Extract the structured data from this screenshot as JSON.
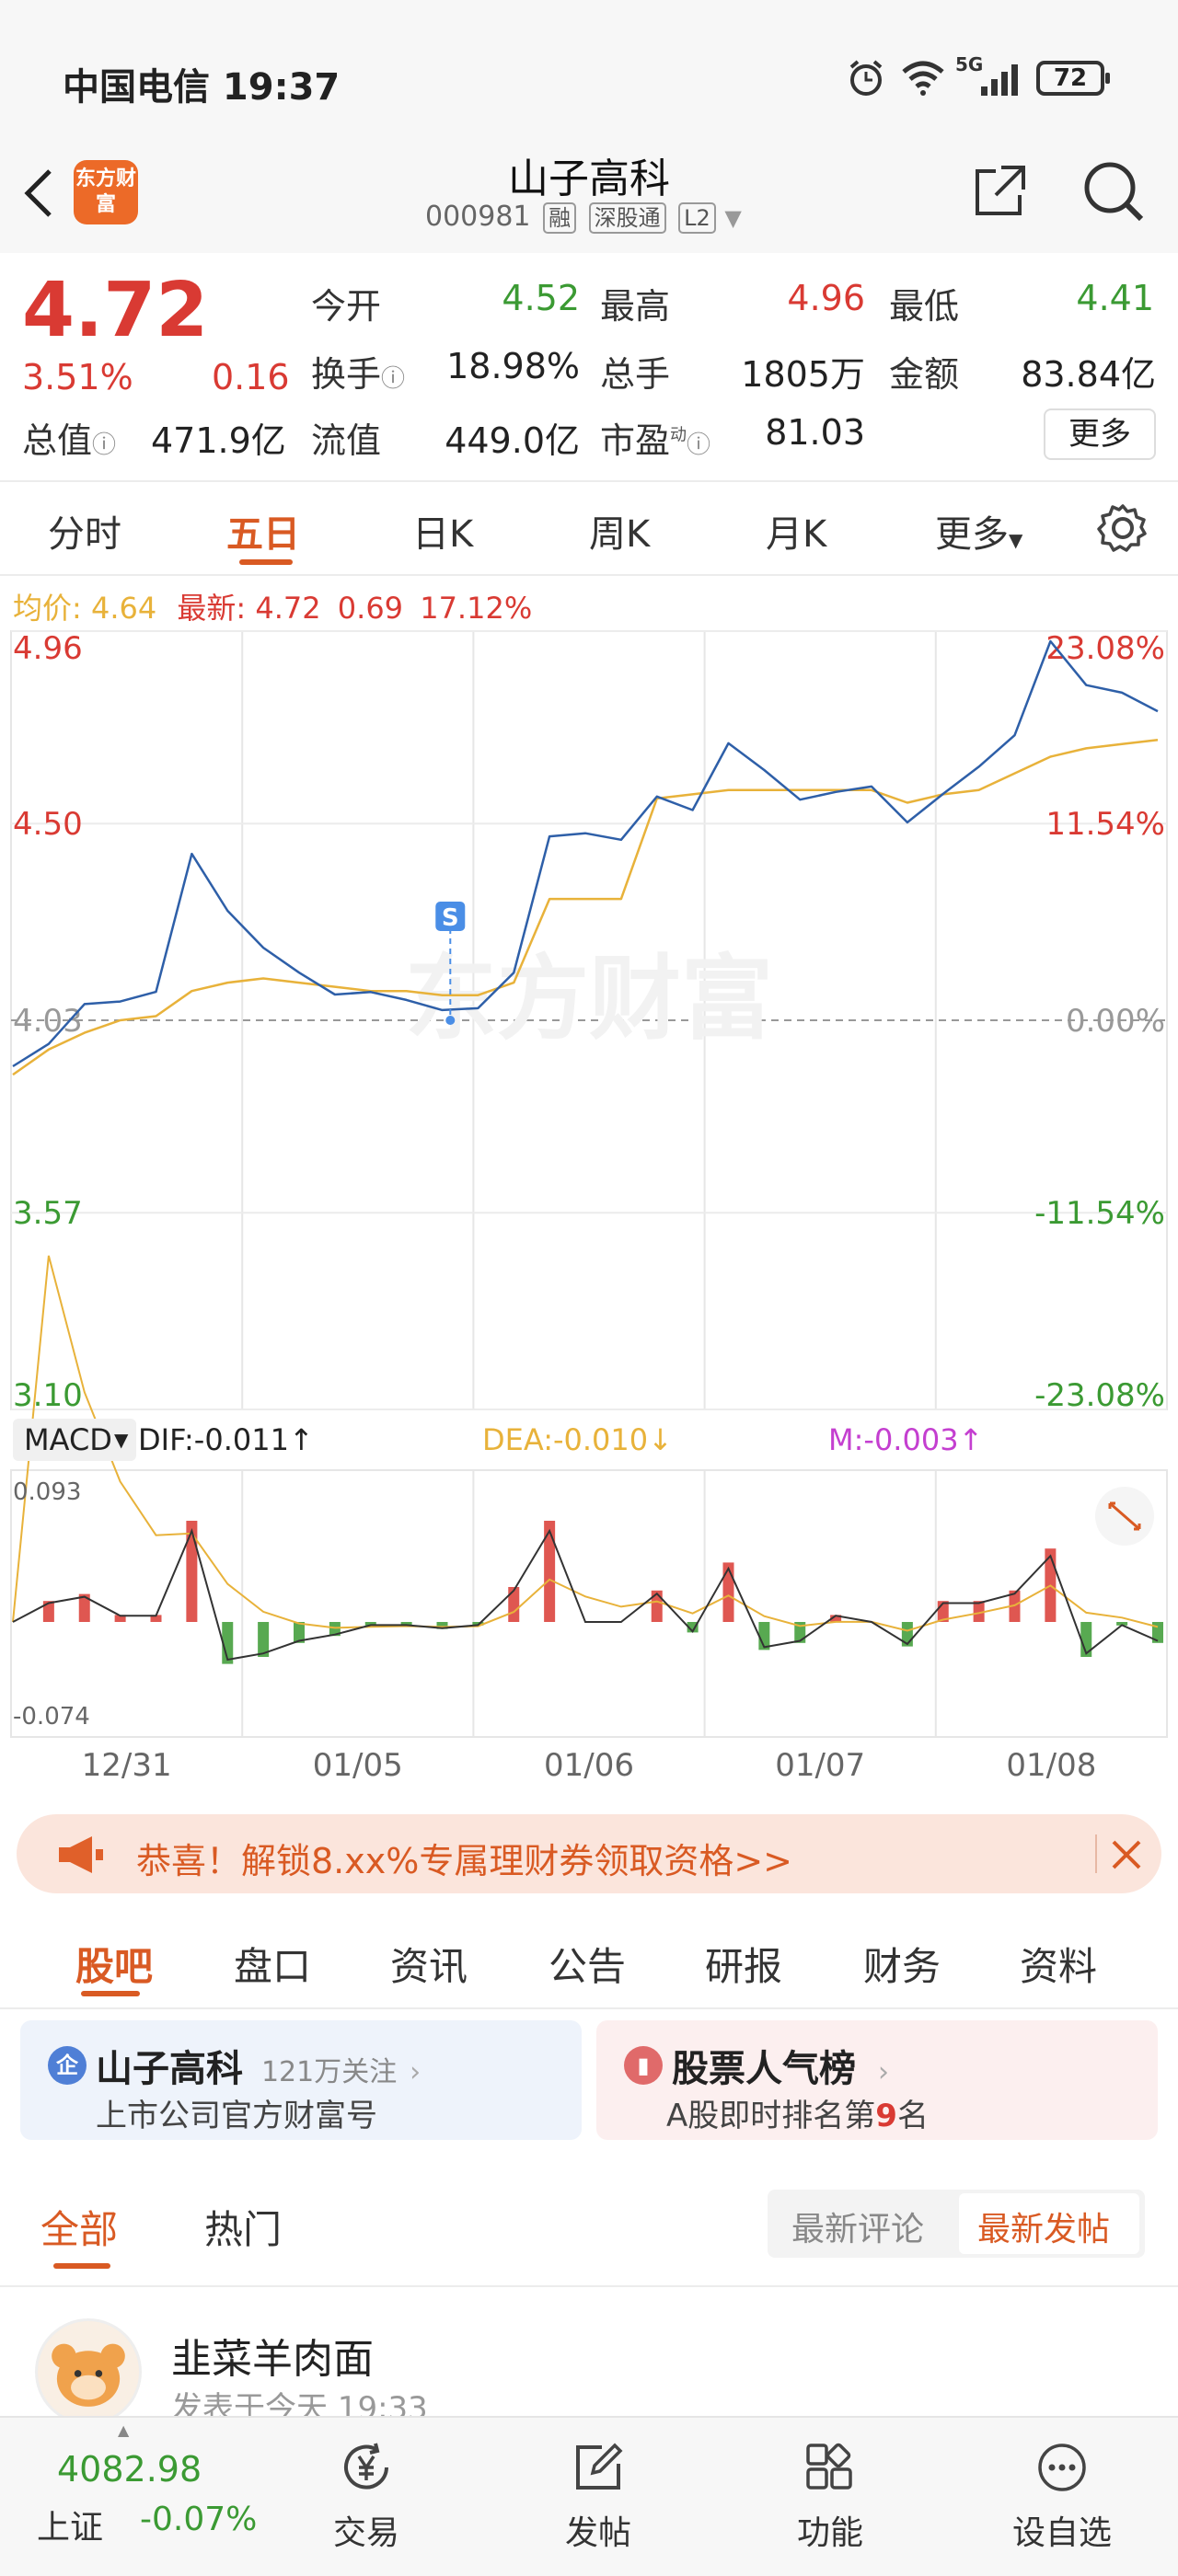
{
  "status_bar": {
    "carrier_time": "中国电信 19:37",
    "network": "5G",
    "battery": "72"
  },
  "header": {
    "logo_text": "东方财富",
    "stock_name": "山子高科",
    "stock_code": "000981",
    "tags": [
      "融",
      "深股通",
      "L2"
    ]
  },
  "quote": {
    "price": "4.72",
    "change_pct": "3.51%",
    "change": "0.16",
    "open_label": "今开",
    "open": "4.52",
    "high_label": "最高",
    "high": "4.96",
    "low_label": "最低",
    "low": "4.41",
    "turnover_label": "换手",
    "turnover": "18.98%",
    "volume_label": "总手",
    "volume": "1805万",
    "amount_label": "金额",
    "amount": "83.84亿",
    "total_cap_label": "总值",
    "total_cap": "471.9亿",
    "float_cap_label": "流值",
    "float_cap": "449.0亿",
    "pe_label": "市盈",
    "pe_sup": "动",
    "pe": "81.03",
    "more_button": "更多"
  },
  "period_tabs": [
    "分时",
    "五日",
    "日K",
    "周K",
    "月K",
    "更多"
  ],
  "active_period": "五日",
  "info_row": {
    "avg_label": "均价:",
    "avg": "4.64",
    "latest_label": "最新:",
    "latest": "4.72",
    "change": "0.69",
    "change_pct": "17.12%"
  },
  "chart_data": {
    "type": "line",
    "title": "",
    "x": [
      "12/31",
      "01/05",
      "01/06",
      "01/07",
      "01/08"
    ],
    "y_ticks_left": [
      "4.96",
      "4.50",
      "4.03",
      "3.57",
      "3.10"
    ],
    "y_ticks_right": [
      "23.08%",
      "11.54%",
      "0.00%",
      "-11.54%",
      "-23.08%"
    ],
    "ylim": [
      3.1,
      4.96
    ],
    "prev_close": 4.03,
    "series": [
      {
        "name": "",
        "color": "#2e5fa8",
        "values": [
          3.92,
          3.98,
          4.06,
          4.08,
          4.1,
          4.42,
          4.3,
          4.2,
          4.14,
          4.1,
          4.09,
          4.08,
          4.06,
          4.05,
          4.15,
          4.47,
          4.47,
          4.47,
          4.56,
          4.53,
          4.7,
          4.62,
          4.56,
          4.58,
          4.58,
          4.51,
          4.57,
          4.63,
          4.72,
          4.93,
          4.83,
          4.82,
          4.76
        ]
      },
      {
        "name": "均价",
        "color": "#e8b23a",
        "values": [
          3.9,
          3.96,
          4.0,
          4.03,
          4.04,
          4.1,
          4.12,
          4.13,
          4.12,
          4.11,
          4.1,
          4.1,
          4.09,
          4.09,
          4.12,
          4.32,
          4.32,
          4.32,
          4.56,
          4.57,
          4.58,
          4.58,
          4.58,
          4.58,
          4.58,
          4.55,
          4.57,
          4.58,
          4.62,
          4.66,
          4.68,
          4.69,
          4.7
        ]
      }
    ],
    "marker": {
      "label": "S"
    },
    "grid": true,
    "watermark": "东方财富"
  },
  "macd": {
    "selector": "MACD",
    "dif": "DIF:-0.011↑",
    "dea": "DEA:-0.010↓",
    "m": "M:-0.003↑",
    "max": "0.093",
    "min": "-0.074"
  },
  "banner": {
    "text": "恭喜！解锁8.xx%专属理财券领取资格>>"
  },
  "section_tabs": [
    "股吧",
    "盘口",
    "资讯",
    "公告",
    "研报",
    "财务",
    "资料"
  ],
  "cards": [
    {
      "icon": "企",
      "title": "山子高科",
      "meta": "121万关注",
      "sub": "上市公司官方财富号"
    },
    {
      "title": "股票人气榜",
      "sub_prefix": "A股即时排名第",
      "rank": "9",
      "sub_suffix": "名"
    }
  ],
  "feed_tabs": [
    "全部",
    "热门"
  ],
  "sort_options": [
    "最新评论",
    "最新发帖"
  ],
  "post": {
    "user": "韭菜羊肉面",
    "time": "发表于今天 19:33"
  },
  "bottom_bar": {
    "index_value": "4082.98",
    "index_name": "上证",
    "index_change": "-0.07%",
    "nav": [
      "交易",
      "发帖",
      "功能",
      "设自选"
    ]
  }
}
